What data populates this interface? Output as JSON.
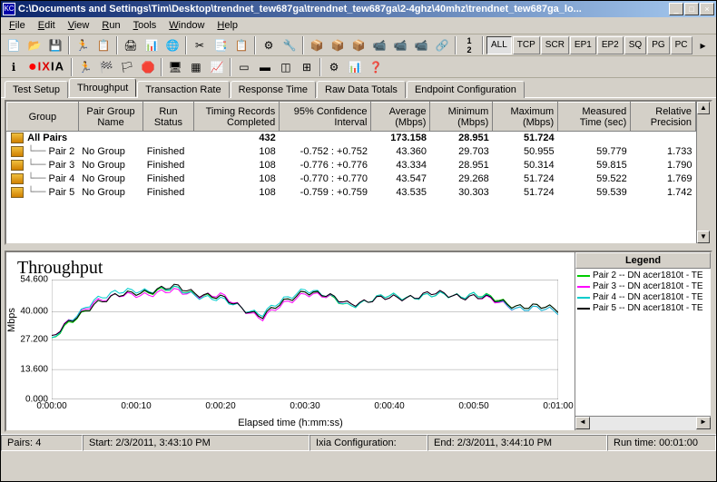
{
  "window": {
    "title": "C:\\Documents and Settings\\Tim\\Desktop\\trendnet_tew687ga\\trendnet_tew687ga\\2-4ghz\\40mhz\\trendnet_tew687ga_lo...",
    "icon_label": "KC"
  },
  "menu": [
    "File",
    "Edit",
    "View",
    "Run",
    "Tools",
    "Window",
    "Help"
  ],
  "toolbar_txt_buttons": [
    "ALL",
    "TCP",
    "SCR",
    "EP1",
    "EP2",
    "SQ",
    "PG",
    "PC"
  ],
  "toolbar_active_txt": "ALL",
  "ixia": "IXIA",
  "tabs": [
    "Test Setup",
    "Throughput",
    "Transaction Rate",
    "Response Time",
    "Raw Data Totals",
    "Endpoint Configuration"
  ],
  "active_tab": "Throughput",
  "table": {
    "columns": [
      "Group",
      "Pair Group Name",
      "Run Status",
      "Timing Records Completed",
      "95% Confidence Interval",
      "Average (Mbps)",
      "Minimum (Mbps)",
      "Maximum (Mbps)",
      "Measured Time (sec)",
      "Relative Precision"
    ],
    "all_pairs": {
      "label": "All Pairs",
      "timing": "432",
      "avg": "173.158",
      "min": "28.951",
      "max": "51.724"
    },
    "rows": [
      {
        "group": "Pair 2",
        "pg": "No Group",
        "status": "Finished",
        "timing": "108",
        "ci": "-0.752 : +0.752",
        "avg": "43.360",
        "min": "29.703",
        "max": "50.955",
        "time": "59.779",
        "prec": "1.733"
      },
      {
        "group": "Pair 3",
        "pg": "No Group",
        "status": "Finished",
        "timing": "108",
        "ci": "-0.776 : +0.776",
        "avg": "43.334",
        "min": "28.951",
        "max": "50.314",
        "time": "59.815",
        "prec": "1.790"
      },
      {
        "group": "Pair 4",
        "pg": "No Group",
        "status": "Finished",
        "timing": "108",
        "ci": "-0.770 : +0.770",
        "avg": "43.547",
        "min": "29.268",
        "max": "51.724",
        "time": "59.522",
        "prec": "1.769"
      },
      {
        "group": "Pair 5",
        "pg": "No Group",
        "status": "Finished",
        "timing": "108",
        "ci": "-0.759 : +0.759",
        "avg": "43.535",
        "min": "30.303",
        "max": "51.724",
        "time": "59.539",
        "prec": "1.742"
      }
    ]
  },
  "chart_data": {
    "type": "line",
    "title": "Throughput",
    "xlabel": "Elapsed time (h:mm:ss)",
    "ylabel": "Mbps",
    "ylim": [
      0,
      54.6
    ],
    "yticks": [
      0.0,
      13.6,
      27.2,
      40.0,
      54.6
    ],
    "yticks_labels": [
      "0.000",
      "13.600",
      "27.200",
      "40.000",
      "54.600"
    ],
    "x": [
      0,
      5,
      10,
      15,
      20,
      25,
      30,
      35,
      40,
      45,
      50,
      55,
      60
    ],
    "xticks_labels": [
      "0:00:00",
      "0:00:10",
      "0:00:20",
      "0:00:30",
      "0:00:40",
      "0:00:50",
      "0:01:00"
    ],
    "series": [
      {
        "name": "Pair 2 -- DN acer1810t - TE",
        "color": "#00cc00",
        "values": [
          27,
          44,
          49,
          50,
          46,
          38,
          50,
          43,
          47,
          47,
          48,
          43,
          41
        ]
      },
      {
        "name": "Pair 3 -- DN acer1810t - TE",
        "color": "#ff00ff",
        "values": [
          28,
          45,
          48,
          49,
          47,
          37,
          49,
          44,
          46,
          48,
          47,
          42,
          40
        ]
      },
      {
        "name": "Pair 4 -- DN acer1810t - TE",
        "color": "#00cccc",
        "values": [
          27,
          46,
          50,
          50,
          45,
          39,
          51,
          43,
          47,
          47,
          48,
          42,
          40
        ]
      },
      {
        "name": "Pair 5 -- DN acer1810t - TE",
        "color": "#000000",
        "values": [
          28,
          44,
          49,
          51,
          46,
          38,
          50,
          44,
          46,
          48,
          47,
          43,
          41
        ]
      }
    ]
  },
  "legend_header": "Legend",
  "status": {
    "pairs_label": "Pairs:",
    "pairs": "4",
    "start_label": "Start:",
    "start": "2/3/2011, 3:43:10 PM",
    "config_label": "Ixia Configuration:",
    "end_label": "End:",
    "end": "2/3/2011, 3:44:10 PM",
    "runtime_label": "Run time:",
    "runtime": "00:01:00"
  }
}
